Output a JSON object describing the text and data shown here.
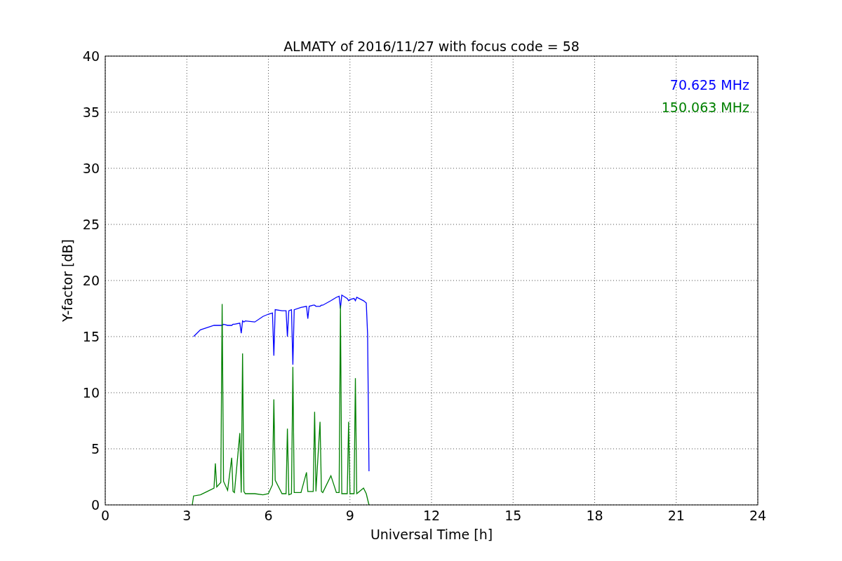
{
  "figure": {
    "chart_data": {
      "type": "line",
      "title": "ALMATY of 2016/11/27 with focus code = 58",
      "xlabel": "Universal Time [h]",
      "ylabel": "Y-factor [dB]",
      "xlim": [
        0,
        24
      ],
      "ylim": [
        0,
        40
      ],
      "xticks": [
        0,
        3,
        6,
        9,
        12,
        15,
        18,
        21,
        24
      ],
      "yticks": [
        0,
        5,
        10,
        15,
        20,
        25,
        30,
        35,
        40
      ],
      "grid": true,
      "x": [
        3.2,
        3.25,
        3.5,
        3.75,
        4.0,
        4.05,
        4.1,
        4.25,
        4.3,
        4.35,
        4.5,
        4.65,
        4.7,
        4.75,
        4.95,
        5.0,
        5.05,
        5.1,
        5.15,
        5.5,
        5.8,
        6.0,
        6.15,
        6.2,
        6.25,
        6.5,
        6.65,
        6.7,
        6.75,
        6.85,
        6.9,
        6.95,
        7.2,
        7.4,
        7.45,
        7.5,
        7.65,
        7.7,
        7.75,
        7.9,
        7.95,
        8.0,
        8.3,
        8.5,
        8.6,
        8.65,
        8.7,
        8.9,
        8.95,
        9.0,
        9.15,
        9.2,
        9.25,
        9.5,
        9.6,
        9.65,
        9.7
      ],
      "series": [
        {
          "name": "70.625 MHz",
          "color": "#0000ff",
          "values": [
            null,
            15,
            15.6,
            15.8,
            16,
            16,
            16,
            16,
            16,
            16.1,
            16,
            16,
            16.1,
            16.1,
            16.2,
            15.3,
            16.4,
            16.3,
            16.4,
            16.3,
            16.8,
            17,
            17.1,
            13.3,
            17.4,
            17.3,
            17.3,
            15,
            17.3,
            17.4,
            12.5,
            17.4,
            17.6,
            17.7,
            16.6,
            17.7,
            17.8,
            17.8,
            17.7,
            17.7,
            17.8,
            17.8,
            18.2,
            18.5,
            18.6,
            17.5,
            18.7,
            18.4,
            18.2,
            18.3,
            18.4,
            18.2,
            18.5,
            18.2,
            18,
            15.2,
            3
          ]
        },
        {
          "name": "150.063 MHz",
          "color": "#008000",
          "values": [
            0,
            0.8,
            0.9,
            1.2,
            1.5,
            3.7,
            1.6,
            2.0,
            17.9,
            2.1,
            1.3,
            4.2,
            1.2,
            1.1,
            6.4,
            1.1,
            13.5,
            1.2,
            1.0,
            1.0,
            0.9,
            1.0,
            1.8,
            9.4,
            2.2,
            1.0,
            1.0,
            6.8,
            0.9,
            1.0,
            12.3,
            1.1,
            1.1,
            2.9,
            1.2,
            1.2,
            1.2,
            8.3,
            1.2,
            7.4,
            1.2,
            1.1,
            2.6,
            1.1,
            1.1,
            17.8,
            1.0,
            1.0,
            7.4,
            1.0,
            1.0,
            11.3,
            1.0,
            1.5,
            1.0,
            0.5,
            0
          ]
        }
      ]
    }
  }
}
